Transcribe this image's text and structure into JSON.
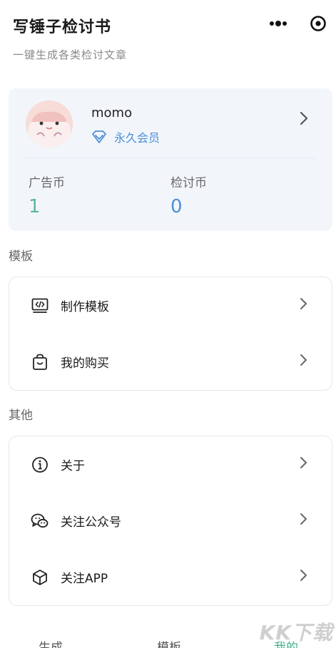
{
  "header": {
    "title": "写锤子检讨书",
    "subtitle": "一键生成各类检讨文章"
  },
  "capsule": {
    "more_icon": "more-dots-icon",
    "close_icon": "target-close-icon"
  },
  "profile": {
    "username": "momo",
    "membership": "永久会员",
    "stats": [
      {
        "label": "广告币",
        "value": "1"
      },
      {
        "label": "检讨币",
        "value": "0"
      }
    ]
  },
  "sections": {
    "templates": {
      "title": "模板",
      "items": [
        {
          "label": "制作模板",
          "icon": "code-window-icon"
        },
        {
          "label": "我的购买",
          "icon": "shopping-bag-icon"
        }
      ]
    },
    "other": {
      "title": "其他",
      "items": [
        {
          "label": "关于",
          "icon": "info-icon"
        },
        {
          "label": "关注公众号",
          "icon": "wechat-icon"
        },
        {
          "label": "关注APP",
          "icon": "cube-icon"
        }
      ]
    }
  },
  "tabbar": {
    "tabs": [
      {
        "label": "生成"
      },
      {
        "label": "模板"
      },
      {
        "label": "我的",
        "active": true
      }
    ]
  },
  "watermark": "KK下载",
  "colors": {
    "accent_green": "#3bb08a",
    "accent_blue": "#4c8fd6",
    "card_bg": "#f2f6fb"
  }
}
